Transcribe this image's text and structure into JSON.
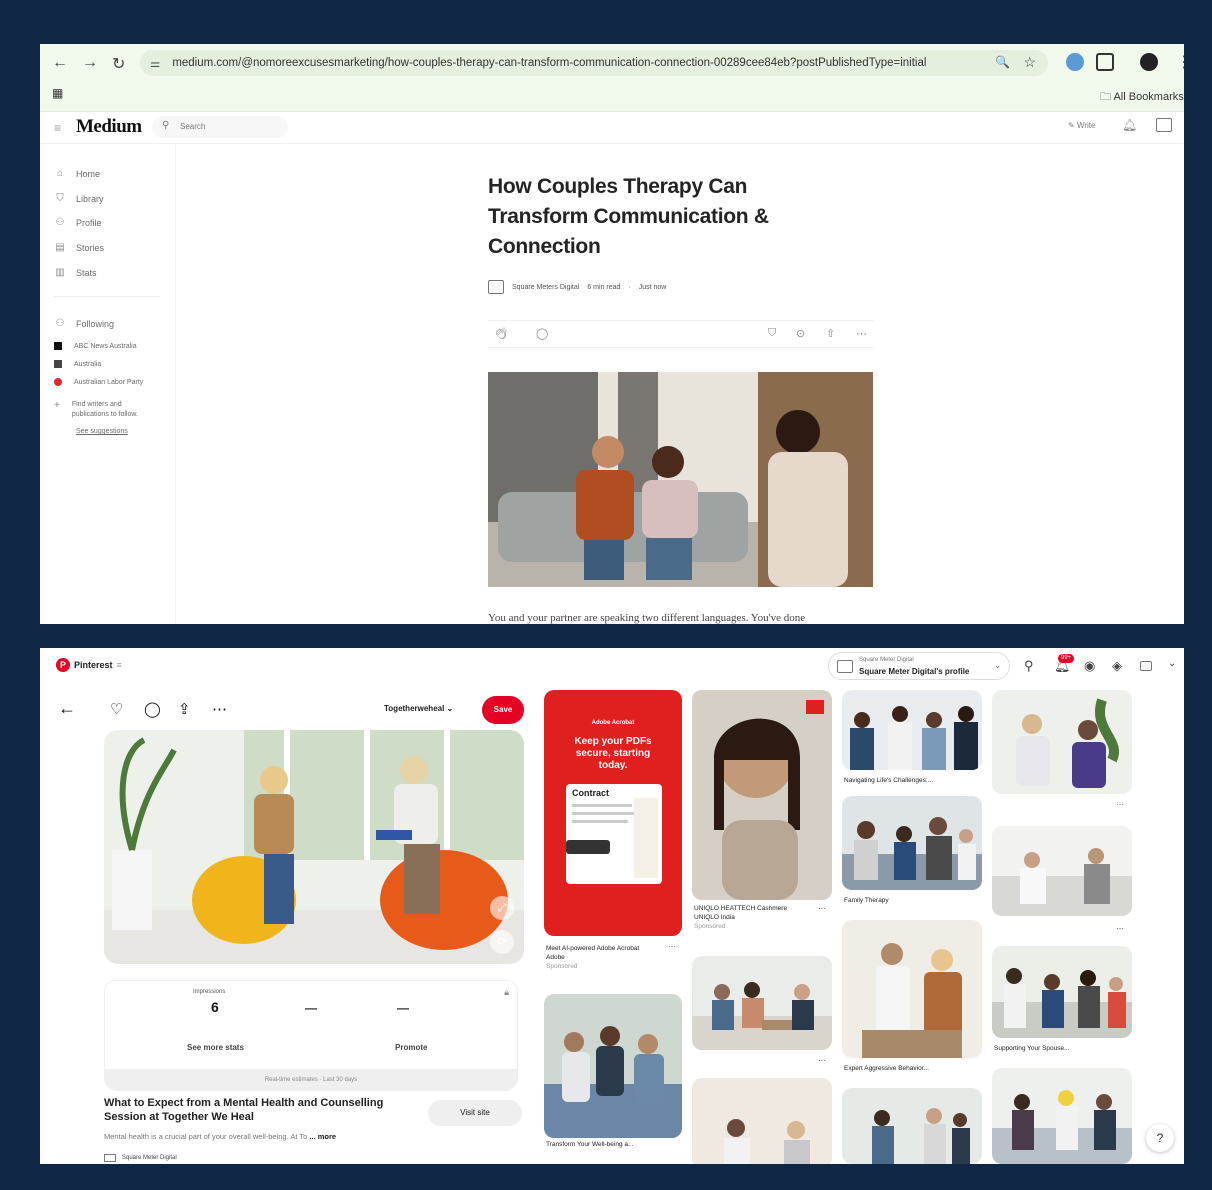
{
  "browser": {
    "url": "medium.com/@nomoreexcusesmarketing/how-couples-therapy-can-transform-communication-connection-00289cee84eb?postPublishedType=initial",
    "bookmarks_label": "All Bookmarks"
  },
  "medium": {
    "logo": "Medium",
    "search_placeholder": "Search",
    "write_label": "Write",
    "sidebar": [
      {
        "label": "Home",
        "icon": "home-icon"
      },
      {
        "label": "Library",
        "icon": "bookmark-icon"
      },
      {
        "label": "Profile",
        "icon": "profile-icon"
      },
      {
        "label": "Stories",
        "icon": "document-icon"
      },
      {
        "label": "Stats",
        "icon": "chart-icon"
      }
    ],
    "following_label": "Following",
    "following": [
      {
        "label": "ABC News Australia",
        "color": "#111111"
      },
      {
        "label": "Australia",
        "color": "#2a2a2a"
      },
      {
        "label": "Australian Labor Party",
        "color": "#e1262c"
      }
    ],
    "find_writers": "Find writers and publications to follow.",
    "see_suggestions": "See suggestions",
    "article": {
      "title": "How Couples Therapy Can Transform Communication & Connection",
      "author": "Square Meters Digital",
      "read_time": "6 min read",
      "published": "Just now",
      "intro": "You and your partner are speaking two different languages. You've done"
    }
  },
  "pinterest": {
    "logo": "Pinterest",
    "profile_account": "Square Meter Digital",
    "profile_label": "Square Meter Digital's profile",
    "notification_badge": "99+",
    "board": "Togetherweheal",
    "save_label": "Save",
    "stats": {
      "impressions_label": "Impressions",
      "impressions_value": "6",
      "dash1": "—",
      "dash2": "—",
      "see_more": "See more stats",
      "promote": "Promote",
      "footer": "Real-time estimates · Last 30 days"
    },
    "pin_title": "What to Expect from a Mental Health and Counselling Session at Together We Heal",
    "visit_label": "Visit site",
    "pin_description": "Mental health is a crucial part of your overall well-being. At To",
    "more_label": "... more",
    "pin_author": "Square Meter Digital",
    "ad1": {
      "brand": "Adobe Acrobat",
      "headline": "Keep your PDFs secure, starting today.",
      "doc_title": "Contract",
      "caption": "Meet AI-powered Adobe Acrobat",
      "advertiser": "Adobe",
      "sponsored": "Sponsored"
    },
    "ad2": {
      "caption": "UNIQLO HEATTECH Cashmere",
      "advertiser": "UNIQLO India",
      "sponsored": "Sponsored"
    },
    "captions": {
      "c1": "Navigating Life's Challenges:...",
      "c2": "Family Therapy",
      "c3": "Expert Aggressive Behavior...",
      "c4": "Supporting Your Spouse...",
      "c5": "Transform Your Well-being a..."
    },
    "help_label": "?"
  }
}
